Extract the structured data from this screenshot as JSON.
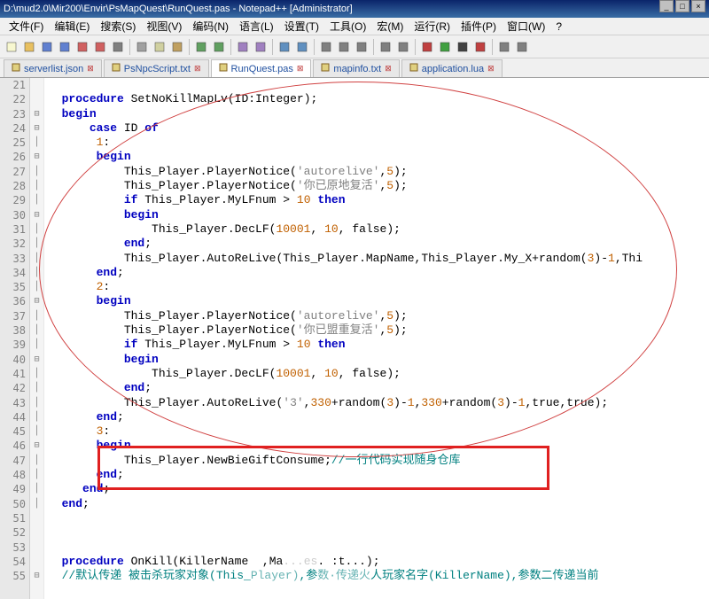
{
  "title": "D:\\mud2.0\\Mir200\\Envir\\PsMapQuest\\RunQuest.pas - Notepad++ [Administrator]",
  "menus": [
    "文件(F)",
    "编辑(E)",
    "搜索(S)",
    "视图(V)",
    "编码(N)",
    "语言(L)",
    "设置(T)",
    "工具(O)",
    "宏(M)",
    "运行(R)",
    "插件(P)",
    "窗口(W)",
    "?"
  ],
  "tabs": [
    {
      "label": "serverlist.json",
      "active": false
    },
    {
      "label": "PsNpcScript.txt",
      "active": false
    },
    {
      "label": "RunQuest.pas",
      "active": true
    },
    {
      "label": "mapinfo.txt",
      "active": false
    },
    {
      "label": "application.lua",
      "active": false
    }
  ],
  "lines": [
    {
      "n": 21,
      "f": "",
      "c": ""
    },
    {
      "n": 22,
      "f": "",
      "c": "  <span class='kw'>procedure</span> SetNoKillMapLv<span class='op'>(</span>ID<span class='op'>:</span>Integer<span class='op'>);</span>"
    },
    {
      "n": 23,
      "f": "⊟",
      "c": "  <span class='kw'>begin</span>"
    },
    {
      "n": 24,
      "f": "⊟",
      "c": "      <span class='kw'>case</span> ID <span class='kw'>of</span>"
    },
    {
      "n": 25,
      "f": "│",
      "c": "       <span class='num'>1</span><span class='op'>:</span>"
    },
    {
      "n": 26,
      "f": "⊟",
      "c": "       <span class='kw'>begin</span>"
    },
    {
      "n": 27,
      "f": "│",
      "c": "           This_Player.PlayerNotice<span class='op'>(</span><span class='str'>'autorelive'</span><span class='op'>,</span><span class='num'>5</span><span class='op'>);</span>"
    },
    {
      "n": 28,
      "f": "│",
      "c": "           This_Player.PlayerNotice<span class='op'>(</span><span class='str'>'你已原地复活'</span><span class='op'>,</span><span class='num'>5</span><span class='op'>);</span>"
    },
    {
      "n": 29,
      "f": "│",
      "c": "           <span class='kw'>if</span> This_Player.MyLFnum <span class='op'>&gt;</span> <span class='num'>10</span> <span class='kw'>then</span>"
    },
    {
      "n": 30,
      "f": "⊟",
      "c": "           <span class='kw'>begin</span>"
    },
    {
      "n": 31,
      "f": "│",
      "c": "               This_Player.DecLF<span class='op'>(</span><span class='num'>10001</span><span class='op'>,</span> <span class='num'>10</span><span class='op'>,</span> false<span class='op'>);</span>"
    },
    {
      "n": 32,
      "f": "│",
      "c": "           <span class='kw'>end</span><span class='op'>;</span>"
    },
    {
      "n": 33,
      "f": "│",
      "c": "           This_Player.AutoReLive<span class='op'>(</span>This_Player.MapName<span class='op'>,</span>This_Player.My_X<span class='op'>+</span>random<span class='op'>(</span><span class='num'>3</span><span class='op'>)-</span><span class='num'>1</span><span class='op'>,</span>Thi"
    },
    {
      "n": 34,
      "f": "│",
      "c": "       <span class='kw'>end</span><span class='op'>;</span>"
    },
    {
      "n": 35,
      "f": "│",
      "c": "       <span class='num'>2</span><span class='op'>:</span>"
    },
    {
      "n": 36,
      "f": "⊟",
      "c": "       <span class='kw'>begin</span>"
    },
    {
      "n": 37,
      "f": "│",
      "c": "           This_Player.PlayerNotice<span class='op'>(</span><span class='str'>'autorelive'</span><span class='op'>,</span><span class='num'>5</span><span class='op'>);</span>"
    },
    {
      "n": 38,
      "f": "│",
      "c": "           This_Player.PlayerNotice<span class='op'>(</span><span class='str'>'你已盟重复活'</span><span class='op'>,</span><span class='num'>5</span><span class='op'>);</span>"
    },
    {
      "n": 39,
      "f": "│",
      "c": "           <span class='kw'>if</span> This_Player.MyLFnum <span class='op'>&gt;</span> <span class='num'>10</span> <span class='kw'>then</span>"
    },
    {
      "n": 40,
      "f": "⊟",
      "c": "           <span class='kw'>begin</span>"
    },
    {
      "n": 41,
      "f": "│",
      "c": "               This_Player.DecLF<span class='op'>(</span><span class='num'>10001</span><span class='op'>,</span> <span class='num'>10</span><span class='op'>,</span> false<span class='op'>);</span>"
    },
    {
      "n": 42,
      "f": "│",
      "c": "           <span class='kw'>end</span><span class='op'>;</span>"
    },
    {
      "n": 43,
      "f": "│",
      "c": "           This_Player.AutoReLive<span class='op'>(</span><span class='str'>'3'</span><span class='op'>,</span><span class='num'>330</span><span class='op'>+</span>random<span class='op'>(</span><span class='num'>3</span><span class='op'>)-</span><span class='num'>1</span><span class='op'>,</span><span class='num'>330</span><span class='op'>+</span>random<span class='op'>(</span><span class='num'>3</span><span class='op'>)-</span><span class='num'>1</span><span class='op'>,</span>true<span class='op'>,</span>true<span class='op'>);</span>"
    },
    {
      "n": 44,
      "f": "│",
      "c": "       <span class='kw'>end</span><span class='op'>;</span>"
    },
    {
      "n": 45,
      "f": "│",
      "c": "       <span class='num'>3</span><span class='op'>:</span>"
    },
    {
      "n": 46,
      "f": "⊟",
      "c": "       <span class='kw'>begin</span>"
    },
    {
      "n": 47,
      "f": "│",
      "c": "           This_Player.NewBieGiftConsume<span class='op'>;</span><span class='cmt'>//一行代码实现随身仓库</span>"
    },
    {
      "n": 48,
      "f": "│",
      "c": "       <span class='kw'>end</span><span class='op'>;</span>"
    },
    {
      "n": 49,
      "f": "│",
      "c": "     <span class='kw'>end</span><span class='op'>;</span>"
    },
    {
      "n": 50,
      "f": "│",
      "c": "  <span class='kw'>end</span><span class='op'>;</span>"
    },
    {
      "n": 51,
      "f": "",
      "c": ""
    },
    {
      "n": 52,
      "f": "",
      "c": ""
    },
    {
      "n": 53,
      "f": "",
      "c": ""
    },
    {
      "n": 54,
      "f": "",
      "c": "  <span class='kw'>procedure</span> OnKill<span class='op'>(</span>KillerName  <span class='op'>,</span>Ma<span style='color:#ccc'>...es</span><span class='op'>. :t...);</span>"
    },
    {
      "n": 55,
      "f": "⊟",
      "c": "  <span class='cmt'>//默认传递 被击杀玩家对象(This_<span style='opacity:.6'>Player)</span>,参<span style='opacity:.6'>数·传递火</span>人玩家名字(KillerName),参数二传递当前</span>"
    }
  ],
  "toolbar_icons": [
    "new",
    "open",
    "save",
    "saveall",
    "close",
    "closeall",
    "print",
    "sep",
    "cut",
    "copy",
    "paste",
    "sep",
    "undo",
    "redo",
    "sep",
    "find",
    "replace",
    "sep",
    "zoomin",
    "zoomout",
    "sep",
    "wrap",
    "allchars",
    "indent",
    "sep",
    "fold",
    "unfold",
    "sep",
    "rec",
    "play",
    "stop",
    "playrec",
    "sep",
    "macro1",
    "macro2"
  ]
}
